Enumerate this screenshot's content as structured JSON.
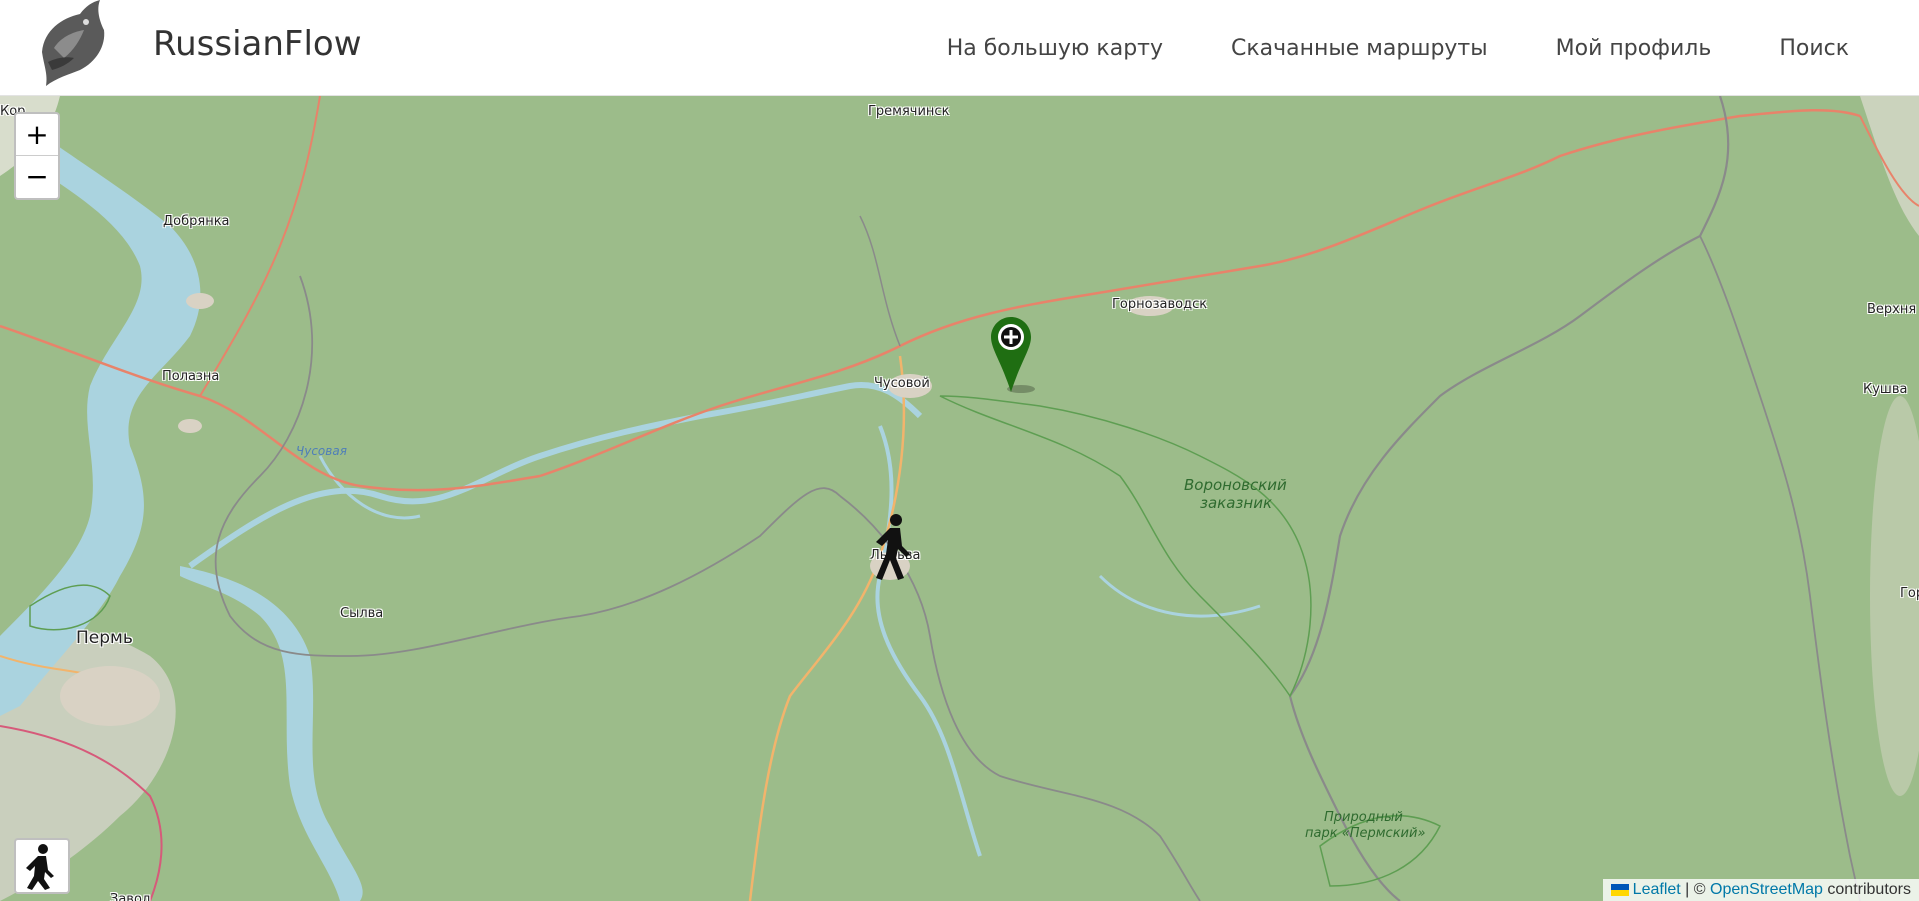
{
  "header": {
    "brand": "RussianFlow",
    "nav": [
      {
        "label": "На большую карту"
      },
      {
        "label": "Скачанные маршруты"
      },
      {
        "label": "Мой профиль"
      },
      {
        "label": "Поиск"
      }
    ]
  },
  "map": {
    "zoom_in_label": "+",
    "zoom_out_label": "−",
    "labels": {
      "gremyachinsk": "Гремячинск",
      "dobryanka": "Добрянка",
      "polazna": "Полазна",
      "chusovaya": "Чусовая",
      "chusovoy": "Чусовой",
      "gornozavodsk": "Горнозаводск",
      "lysva": "Лысьва",
      "sylva": "Сылва",
      "perm": "Пермь",
      "voronovsky_1": "Вороновский",
      "voronovsky_2": "заказник",
      "park_1": "Природный",
      "park_2": "парк «Пермский»",
      "kushva": "Кушва",
      "verkhn": "Верхня",
      "gor": "Гор",
      "kor": "Кор",
      "zavod": "Завод"
    },
    "attribution": {
      "leaflet": "Leaflet",
      "separator": " | © ",
      "osm": "OpenStreetMap",
      "suffix": " contributors"
    },
    "colors": {
      "forest": "#9cbc8a",
      "water": "#aad3df",
      "marker_green": "#1f6e12",
      "road_red": "#e8836a",
      "road_orange": "#f2b46c",
      "border_gray": "#8a8a8a"
    }
  }
}
